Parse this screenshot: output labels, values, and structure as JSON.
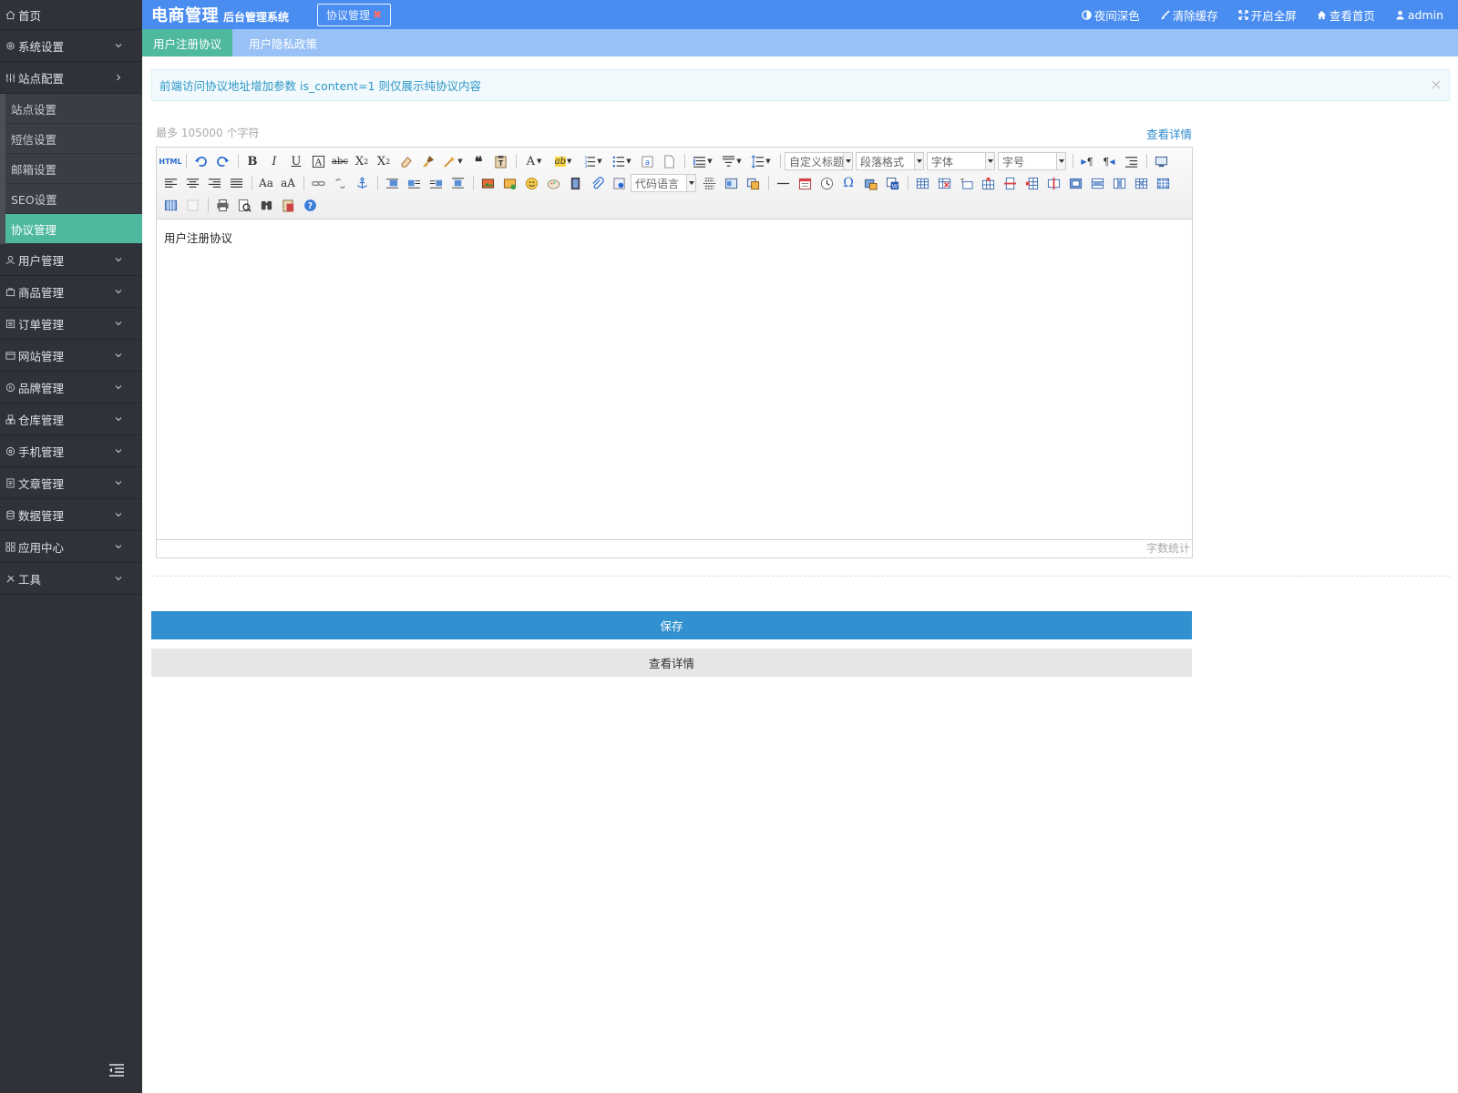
{
  "sidebar": {
    "home": "首页",
    "items": [
      {
        "label": "系统设置",
        "icon": "gear-icon",
        "arrow": "down"
      },
      {
        "label": "站点配置",
        "icon": "sliders-icon",
        "arrow": "right"
      }
    ],
    "sub_items": [
      {
        "label": "站点设置",
        "active": false
      },
      {
        "label": "短信设置",
        "active": false
      },
      {
        "label": "邮箱设置",
        "active": false
      },
      {
        "label": "SEO设置",
        "active": false
      },
      {
        "label": "协议管理",
        "active": true
      }
    ],
    "more_items": [
      {
        "label": "用户管理",
        "icon": "user-icon"
      },
      {
        "label": "商品管理",
        "icon": "bag-icon"
      },
      {
        "label": "订单管理",
        "icon": "list-icon"
      },
      {
        "label": "网站管理",
        "icon": "web-icon"
      },
      {
        "label": "品牌管理",
        "icon": "registered-icon"
      },
      {
        "label": "仓库管理",
        "icon": "boxes-icon"
      },
      {
        "label": "手机管理",
        "icon": "phone-icon"
      },
      {
        "label": "文章管理",
        "icon": "article-icon"
      },
      {
        "label": "数据管理",
        "icon": "database-icon"
      },
      {
        "label": "应用中心",
        "icon": "apps-icon"
      },
      {
        "label": "工具",
        "icon": "tools-icon"
      }
    ]
  },
  "header": {
    "brand": "电商管理",
    "brand_sub": "后台管理系统",
    "open_tab": "协议管理",
    "actions": [
      {
        "label": "夜间深色",
        "icon": "contrast-icon"
      },
      {
        "label": "清除缓存",
        "icon": "brush-icon"
      },
      {
        "label": "开启全屏",
        "icon": "fullscreen-icon"
      },
      {
        "label": "查看首页",
        "icon": "home-icon"
      },
      {
        "label": "admin",
        "icon": "user-icon"
      }
    ]
  },
  "subtabs": [
    {
      "label": "用户注册协议",
      "active": true
    },
    {
      "label": "用户隐私政策",
      "active": false
    }
  ],
  "alert": {
    "text": "前端访问协议地址增加参数 is_content=1 则仅展示纯协议内容"
  },
  "editor": {
    "hint": "最多 105000 个字符",
    "detail_link": "查看详情",
    "content": "用户注册协议",
    "status": "字数统计",
    "combos": {
      "custom_title": "自定义标题",
      "paragraph": "段落格式",
      "font_family": "字体",
      "font_size": "字号",
      "code_lang": "代码语言"
    }
  },
  "buttons": {
    "save": "保存",
    "detail": "查看详情"
  },
  "colors": {
    "sidebar_bg": "#2f3339",
    "accent_green": "#4fb99f",
    "header_blue": "#4a8df0",
    "subtab_blue": "#98c1f6",
    "save_blue": "#3090d0"
  }
}
